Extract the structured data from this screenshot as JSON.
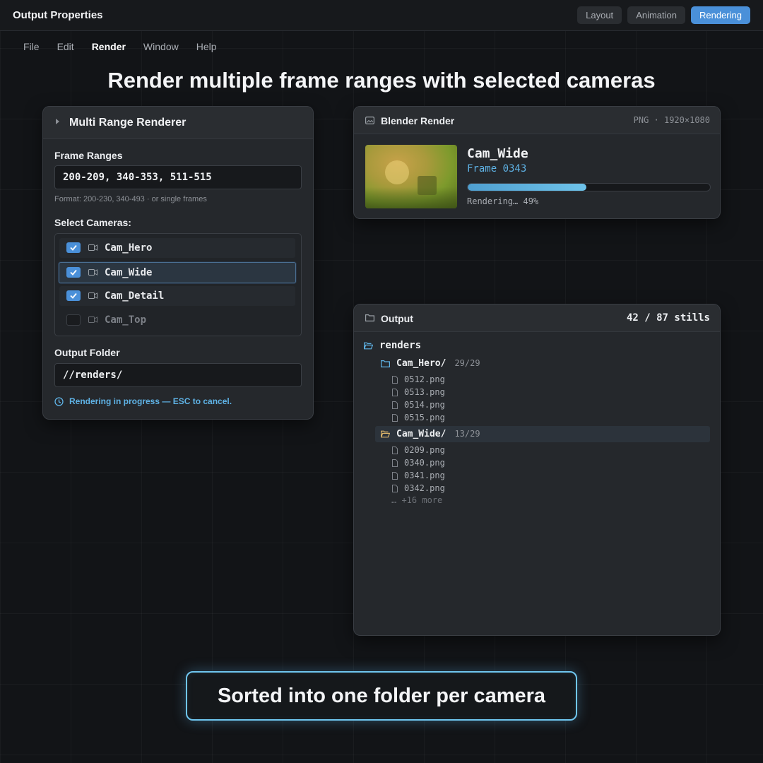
{
  "app": {
    "title": "Output Properties"
  },
  "workspaces": [
    {
      "label": "Layout",
      "active": false
    },
    {
      "label": "Animation",
      "active": false
    },
    {
      "label": "Rendering",
      "active": true
    }
  ],
  "menu": [
    {
      "label": "File",
      "active": false
    },
    {
      "label": "Edit",
      "active": false
    },
    {
      "label": "Render",
      "active": true
    },
    {
      "label": "Window",
      "active": false
    },
    {
      "label": "Help",
      "active": false
    }
  ],
  "headline": "Render multiple frame ranges with selected cameras",
  "multi_range": {
    "title": "Multi Range Renderer",
    "frame_ranges_label": "Frame Ranges",
    "frame_ranges_value": "200-209, 340-353, 511-515",
    "format_hint": "Format: 200-230, 340-493 · or single frames",
    "cameras_label": "Select Cameras:",
    "cameras": [
      {
        "name": "Cam_Hero",
        "checked": true,
        "selected": false
      },
      {
        "name": "Cam_Wide",
        "checked": true,
        "selected": true
      },
      {
        "name": "Cam_Detail",
        "checked": true,
        "selected": false
      },
      {
        "name": "Cam_Top",
        "checked": false,
        "selected": false
      }
    ],
    "output_folder_label": "Output Folder",
    "output_folder_value": "//renders/",
    "status": "Rendering in progress — ESC to cancel."
  },
  "render": {
    "title": "Blender Render",
    "meta": "PNG · 1920×1080",
    "camera": "Cam_Wide",
    "frame": "Frame 0343",
    "progress": 0.49,
    "status": "Rendering… 49%"
  },
  "output": {
    "title": "Output",
    "count": "42 / 87 stills",
    "root": "renders",
    "folders": [
      {
        "name": "Cam_Hero/",
        "count": "29/29",
        "files": [
          "0512.png",
          "0513.png",
          "0514.png",
          "0515.png"
        ]
      },
      {
        "name": "Cam_Wide/",
        "count": "13/29",
        "files": [
          "0209.png",
          "0340.png",
          "0341.png",
          "0342.png"
        ]
      }
    ],
    "more": "… +16 more"
  },
  "caption": "Sorted into one folder per camera",
  "colors": {
    "accent": "#4a90d9",
    "highlight": "#5fb3e6",
    "active_folder": "#d9b36a"
  }
}
